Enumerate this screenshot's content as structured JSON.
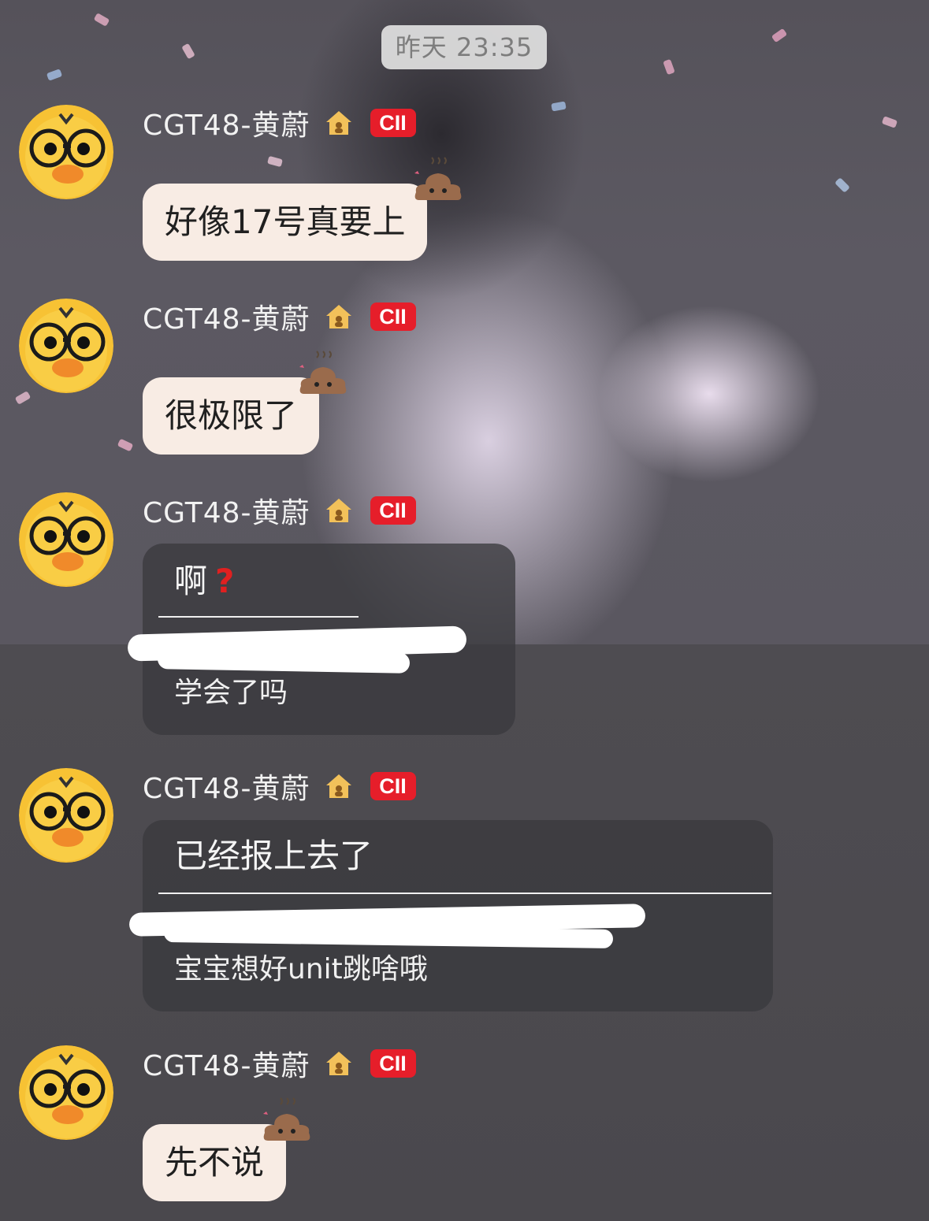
{
  "timestamp": "昨天 23:35",
  "colors": {
    "bubble_light": "#f8ece4",
    "bubble_dark": "#3a3a3e",
    "badge_red": "#e61e2a",
    "name_text": "#f2f2f2"
  },
  "messages": [
    {
      "sender": "CGT48-黄蔚",
      "badge": "CII",
      "badge_icon": "house-icon",
      "text": "好像17号真要上",
      "decor_icon": "poop-icon"
    },
    {
      "sender": "CGT48-黄蔚",
      "badge": "CII",
      "badge_icon": "house-icon",
      "text": "很极限了",
      "decor_icon": "poop-icon"
    },
    {
      "sender": "CGT48-黄蔚",
      "badge": "CII",
      "badge_icon": "house-icon",
      "text": "啊",
      "suffix_icon": "red-question-mark",
      "quoted_reply": "学会了吗"
    },
    {
      "sender": "CGT48-黄蔚",
      "badge": "CII",
      "badge_icon": "house-icon",
      "text": "已经报上去了",
      "quoted_reply": "宝宝想好unit跳啥哦"
    },
    {
      "sender": "CGT48-黄蔚",
      "badge": "CII",
      "badge_icon": "house-icon",
      "text": "先不说",
      "decor_icon": "poop-icon"
    }
  ]
}
